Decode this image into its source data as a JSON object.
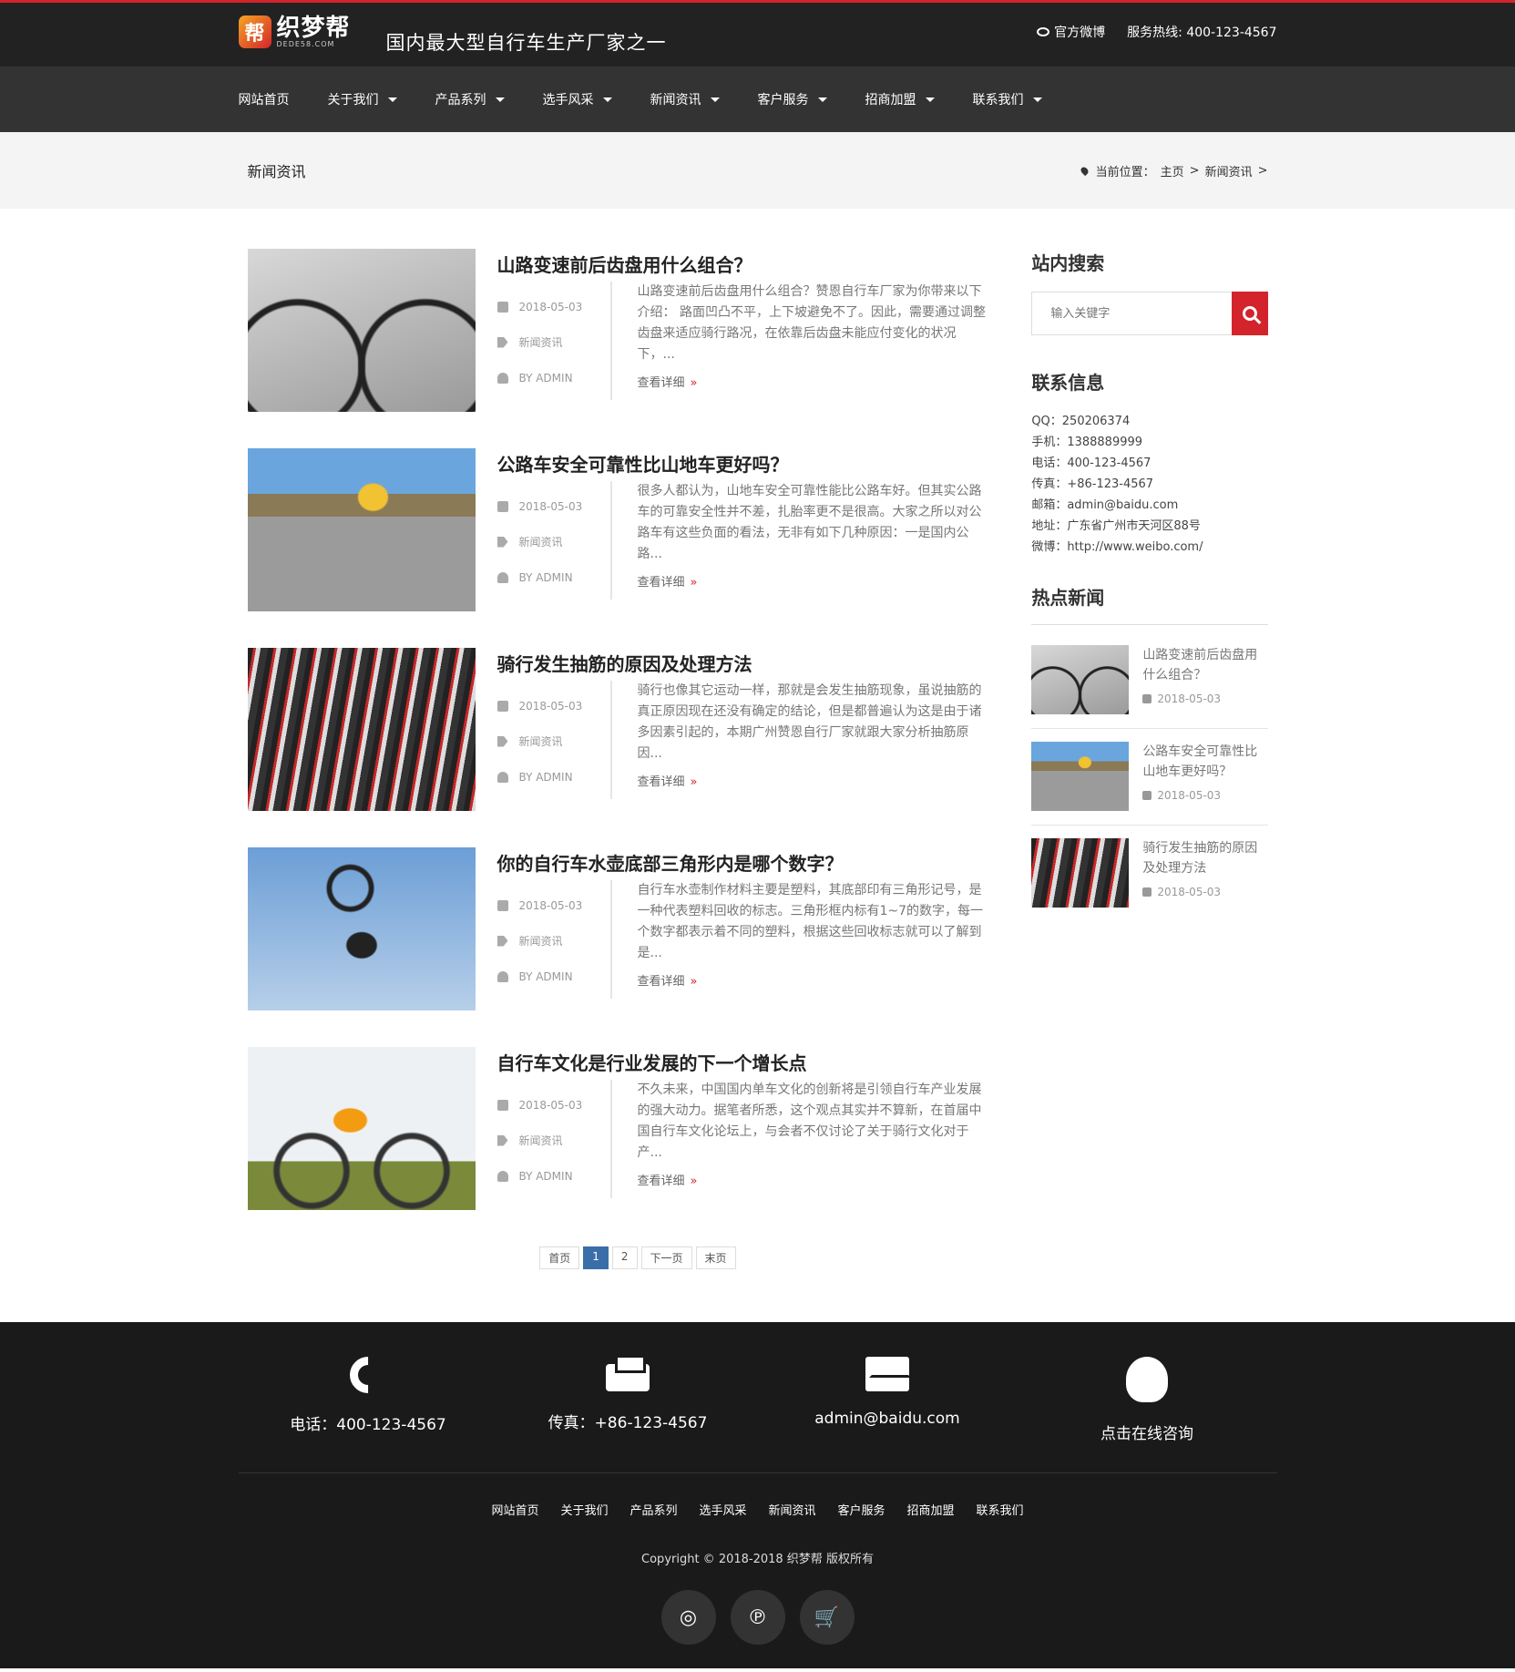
{
  "header": {
    "logo_mark": "帮",
    "logo_cn": "织梦帮",
    "logo_en": "DEDE58.COM",
    "slogan": "国内最大型自行车生产厂家之一",
    "weibo_label": "官方微博",
    "hotline_label": "服务热线: 400-123-4567"
  },
  "nav": [
    {
      "label": "网站首页",
      "dropdown": false
    },
    {
      "label": "关于我们",
      "dropdown": true
    },
    {
      "label": "产品系列",
      "dropdown": true
    },
    {
      "label": "选手风采",
      "dropdown": true
    },
    {
      "label": "新闻资讯",
      "dropdown": true
    },
    {
      "label": "客户服务",
      "dropdown": true
    },
    {
      "label": "招商加盟",
      "dropdown": true
    },
    {
      "label": "联系我们",
      "dropdown": true
    }
  ],
  "crumbbar": {
    "title": "新闻资讯",
    "prefix": "当前位置：",
    "home": "主页",
    "sep": ">",
    "current": "新闻资讯"
  },
  "posts": [
    {
      "title": "山路变速前后齿盘用什么组合？",
      "date": "2018-05-03",
      "category": "新闻资讯",
      "author": "BY ADMIN",
      "excerpt": "山路变速前后齿盘用什么组合？赞恩自行车厂家为你带来以下介绍： 路面凹凸不平，上下坡避免不了。因此，需要通过调整齿盘来适应骑行路况，在依靠后齿盘未能应付变化的状况下，...",
      "more": "查看详细",
      "image": "road-bike-gray"
    },
    {
      "title": "公路车安全可靠性比山地车更好吗？",
      "date": "2018-05-03",
      "category": "新闻资讯",
      "author": "BY ADMIN",
      "excerpt": "很多人都认为，山地车安全可靠性能比公路车好。但其实公路车的可靠安全性并不差，扎胎率更不是很高。大家之所以对公路车有这些负面的看法，无非有如下几种原因：一是国内公路...",
      "more": "查看详细",
      "image": "road-cyclist"
    },
    {
      "title": "骑行发生抽筋的原因及处理方法",
      "date": "2018-05-03",
      "category": "新闻资讯",
      "author": "BY ADMIN",
      "excerpt": "骑行也像其它运动一样，那就是会发生抽筋现象，虽说抽筋的真正原因现在还没有确定的结论，但是都普遍认为这是由于诸多因素引起的，本期广州赞恩自行厂家就跟大家分析抽筋原因...",
      "more": "查看详细",
      "image": "bike-rack"
    },
    {
      "title": "你的自行车水壶底部三角形内是哪个数字？",
      "date": "2018-05-03",
      "category": "新闻资讯",
      "author": "BY ADMIN",
      "excerpt": "自行车水壶制作材料主要是塑料，其底部印有三角形记号，是一种代表塑料回收的标志。三角形框内标有1~7的数字，每一个数字都表示着不同的塑料，根据这些回收标志就可以了解到是...",
      "more": "查看详细",
      "image": "bmx-flip"
    },
    {
      "title": "自行车文化是行业发展的下一个增长点",
      "date": "2018-05-03",
      "category": "新闻资讯",
      "author": "BY ADMIN",
      "excerpt": "不久未来，中国国内单车文化的创新将是引领自行车产业发展的强大动力。据笔者所悉，这个观点其实并不算新，在首届中国自行车文化论坛上，与会者不仅讨论了关于骑行文化对于产...",
      "more": "查看详细",
      "image": "mtb-rider"
    }
  ],
  "pager": [
    "首页",
    "1",
    "2",
    "下一页",
    "末页"
  ],
  "pager_active": "1",
  "sidebar": {
    "search_title": "站内搜索",
    "search_placeholder": "输入关键字",
    "contact_title": "联系信息",
    "contacts": [
      "QQ：250206374",
      "手机：1388889999",
      "电话：400-123-4567",
      "传真：+86-123-4567",
      "邮箱：admin@baidu.com",
      "地址：广东省广州市天河区88号",
      "微博：http://www.weibo.com/"
    ],
    "hot_title": "热点新闻",
    "hot": [
      {
        "title": "山路变速前后齿盘用什么组合？",
        "date": "2018-05-03",
        "image": "road-bike-gray"
      },
      {
        "title": "公路车安全可靠性比山地车更好吗？",
        "date": "2018-05-03",
        "image": "road-cyclist"
      },
      {
        "title": "骑行发生抽筋的原因及处理方法",
        "date": "2018-05-03",
        "image": "bike-rack"
      }
    ]
  },
  "footer": {
    "contacts": [
      {
        "icon": "phone-icon",
        "text": "电话：400-123-4567"
      },
      {
        "icon": "printer-icon",
        "text": "传真：+86-123-4567"
      },
      {
        "icon": "mail-icon",
        "text": "admin@baidu.com"
      },
      {
        "icon": "qq-icon",
        "text": "点击在线咨询"
      }
    ],
    "links": [
      "网站首页",
      "关于我们",
      "产品系列",
      "选手风采",
      "新闻资讯",
      "客户服务",
      "招商加盟",
      "联系我们"
    ],
    "copyright": "Copyright © 2018-2018 织梦帮 版权所有",
    "social": [
      {
        "icon": "weibo-icon",
        "glyph": "◎"
      },
      {
        "icon": "pinterest-icon",
        "glyph": "℗"
      },
      {
        "icon": "cart-icon",
        "glyph": "🛒"
      }
    ]
  },
  "colors": {
    "accent": "#d4242b",
    "header_bg": "#222222",
    "nav_bg": "#333333",
    "footer_bg": "#1a1a1a",
    "pager_active": "#3a6ea8"
  }
}
